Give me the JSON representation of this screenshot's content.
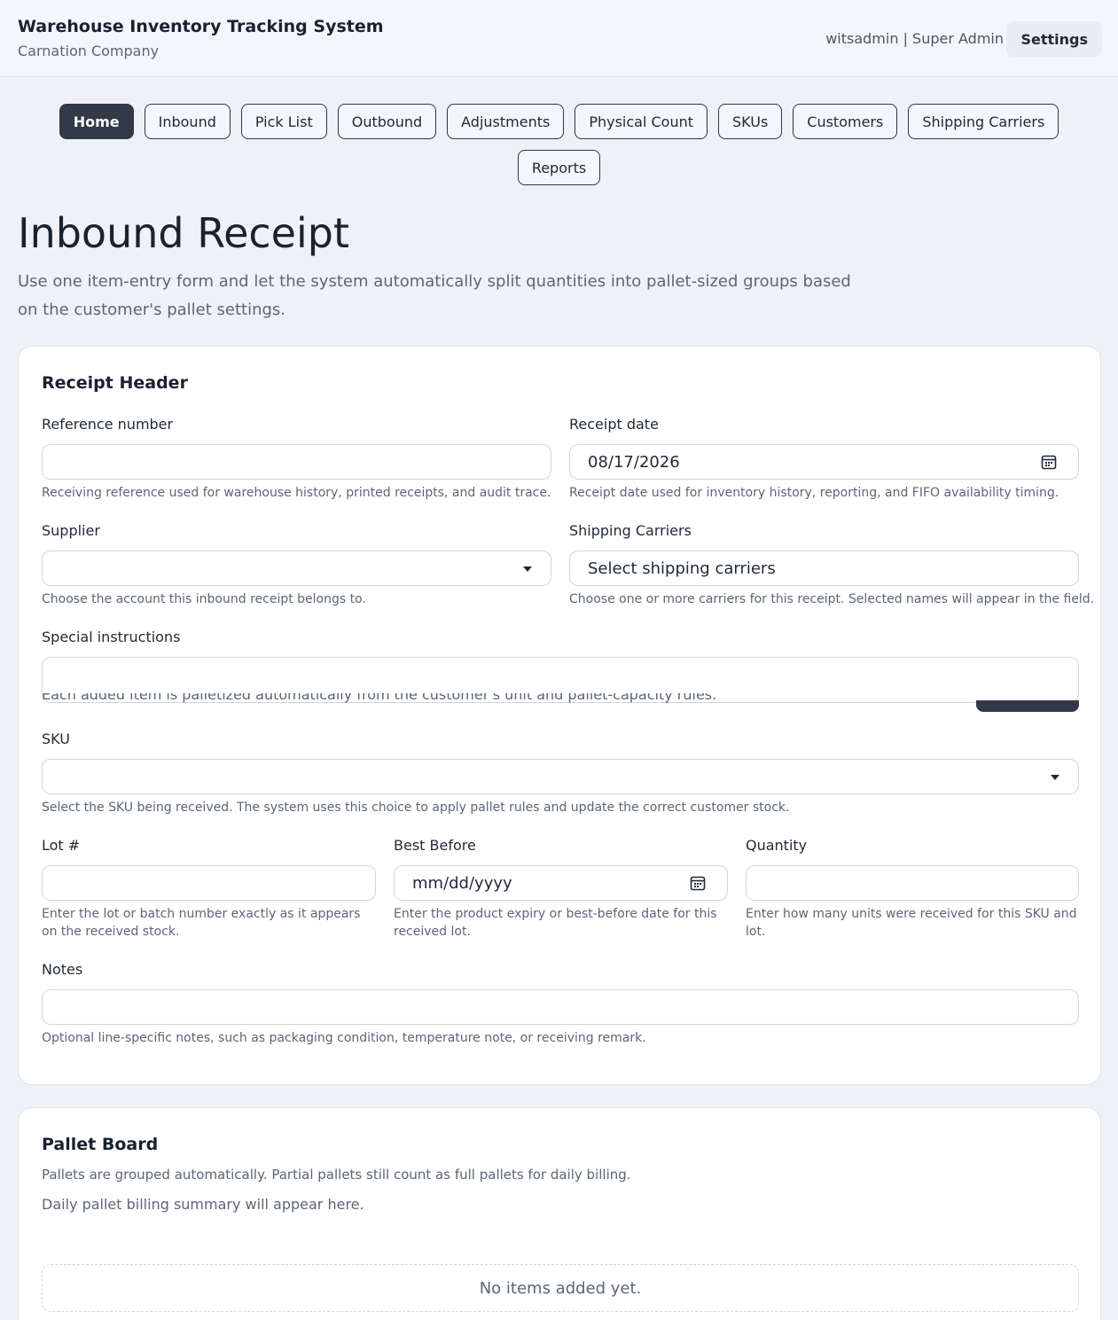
{
  "header": {
    "app_title": "Warehouse Inventory Tracking System",
    "company": "Carnation Company",
    "user": "witsadmin | Super Admin",
    "settings_label": "Settings"
  },
  "nav": {
    "row1": [
      "Home",
      "Inbound",
      "Pick List",
      "Outbound",
      "Adjustments",
      "Physical Count",
      "SKUs",
      "Customers",
      "Shipping Carriers"
    ],
    "row2": [
      "Reports"
    ],
    "active": "Home"
  },
  "page": {
    "title": "Inbound Receipt",
    "description": "Use one item-entry form and let the system automatically split quantities into pallet-sized groups based on the customer's pallet settings."
  },
  "receipt_header": {
    "title": "Receipt Header",
    "reference_label": "Reference number",
    "reference_value": "",
    "reference_help": "Receiving reference used for warehouse history, printed receipts, and audit trace.",
    "date_label": "Receipt date",
    "date_value": "08/17/2026",
    "date_help": "Receipt date used for inventory history, reporting, and FIFO availability timing.",
    "supplier_label": "Supplier",
    "supplier_value": "",
    "supplier_help": "Choose the account this inbound receipt belongs to.",
    "carriers_label": "Shipping Carriers",
    "carriers_placeholder": "Select shipping carriers",
    "carriers_help": "Choose one or more carriers for this receipt. Selected names will appear in the field.",
    "instructions_label": "Special instructions",
    "instructions_value": "",
    "palletize_note": "Each added item is palletized automatically from the customer's unit and pallet-capacity rules.",
    "sku_label": "SKU",
    "sku_value": "",
    "sku_help": "Select the SKU being received. The system uses this choice to apply pallet rules and update the correct customer stock.",
    "lot_label": "Lot #",
    "lot_value": "",
    "lot_help": "Enter the lot or batch number exactly as it appears on the received stock.",
    "best_before_label": "Best Before",
    "best_before_placeholder": "mm/dd/yyyy",
    "best_before_help": "Enter the product expiry or best-before date for this received lot.",
    "quantity_label": "Quantity",
    "quantity_value": "",
    "quantity_help": "Enter how many units were received for this SKU and lot.",
    "notes_label": "Notes",
    "notes_value": "",
    "notes_help": "Optional line-specific notes, such as packaging condition, temperature note, or receiving remark."
  },
  "pallet_board": {
    "title": "Pallet Board",
    "subtitle": "Pallets are grouped automatically. Partial pallets still count as full pallets for daily billing.",
    "billing_summary": "Daily pallet billing summary will appear here.",
    "empty_message": "No items added yet."
  },
  "icons": {
    "calendar": "calendar-icon",
    "dropdown": "chevron-down-icon"
  },
  "colors": {
    "primary_dark": "#323a48",
    "background": "#eef2f8",
    "border": "#cfd6e0"
  }
}
